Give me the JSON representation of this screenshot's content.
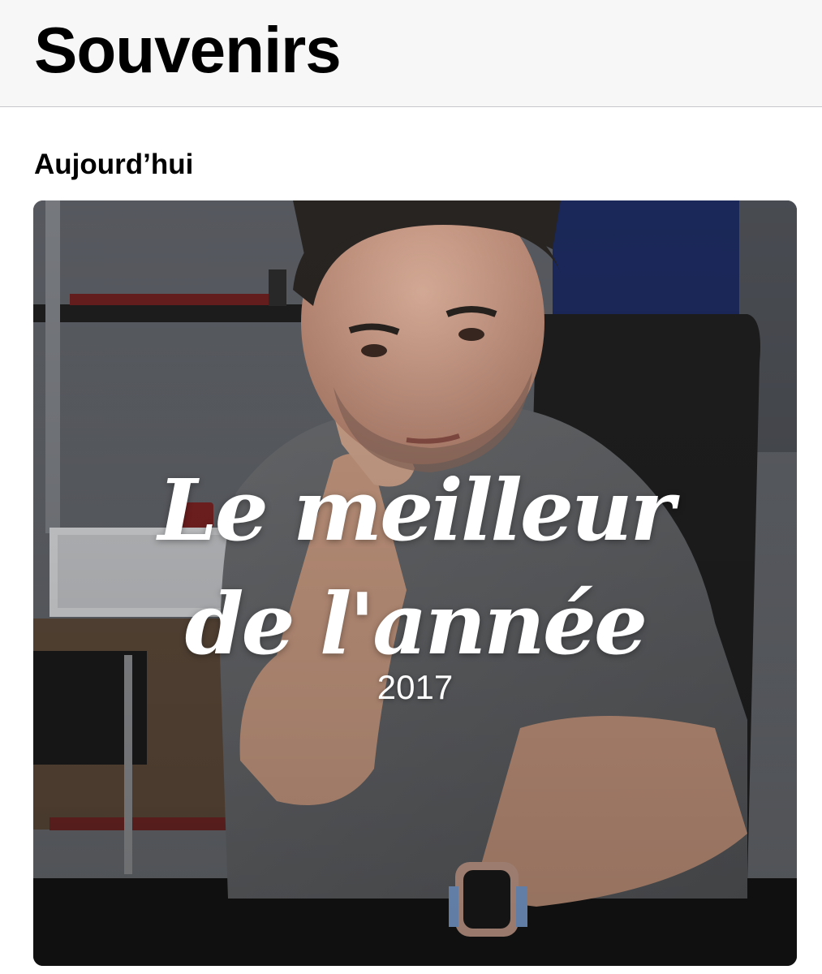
{
  "nav": {
    "title": "Souvenirs"
  },
  "section": {
    "header": "Aujourd’hui"
  },
  "memory": {
    "title_line1": "Le meilleur",
    "title_line2": "de l'année",
    "year": "2017",
    "photo_description_icon": "photo-portrait"
  },
  "colors": {
    "nav_background": "#f7f7f7",
    "text": "#000000",
    "overlay_text": "#ffffff"
  }
}
